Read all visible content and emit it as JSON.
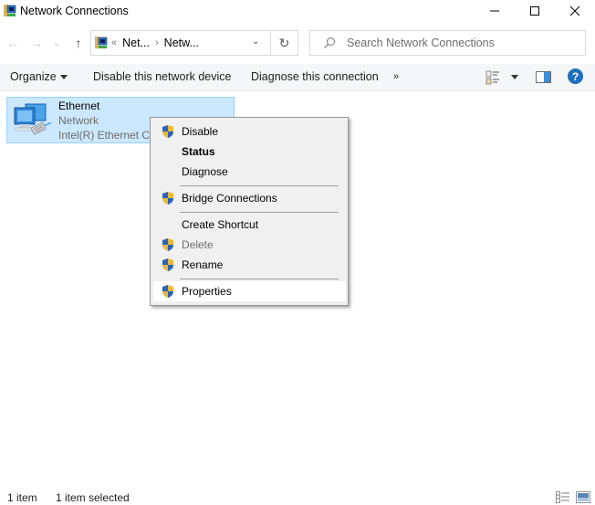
{
  "window": {
    "title": "Network Connections",
    "controls": {
      "minimize": "—",
      "maximize": "☐",
      "close": "✕"
    }
  },
  "navigation": {
    "back_glyph": "←",
    "forward_glyph": "→",
    "recent_glyph": "⌄",
    "up_glyph": "↑",
    "breadcrumb": {
      "overflow": "«",
      "items": [
        "Net...",
        "Netw..."
      ],
      "separator": "›"
    },
    "dropdown_glyph": "⌄",
    "refresh_glyph": "↻",
    "search_placeholder": "Search Network Connections"
  },
  "commandbar": {
    "organize": "Organize",
    "disable_device": "Disable this network device",
    "diagnose": "Diagnose this connection",
    "more": "»",
    "help": "?"
  },
  "items": [
    {
      "name": "Ethernet",
      "type": "Network",
      "device": "Intel(R) Ethernet Co",
      "selected": true
    }
  ],
  "context_menu": {
    "items": [
      {
        "label": "Disable",
        "shield": true,
        "bold": false,
        "disabled": false
      },
      {
        "label": "Status",
        "shield": false,
        "bold": true,
        "disabled": false
      },
      {
        "label": "Diagnose",
        "shield": false,
        "bold": false,
        "disabled": false
      },
      {
        "label": "Bridge Connections",
        "shield": true,
        "bold": false,
        "disabled": false
      },
      {
        "label": "Create Shortcut",
        "shield": false,
        "bold": false,
        "disabled": false
      },
      {
        "label": "Delete",
        "shield": true,
        "bold": false,
        "disabled": true
      },
      {
        "label": "Rename",
        "shield": true,
        "bold": false,
        "disabled": false
      },
      {
        "label": "Properties",
        "shield": true,
        "bold": false,
        "disabled": false,
        "hovered": true
      }
    ]
  },
  "statusbar": {
    "item_count": "1 item",
    "selection": "1 item selected"
  },
  "colors": {
    "selection_bg": "#cce8ff",
    "selection_border": "#99d1ff",
    "menu_bg": "#f0f0f0",
    "help_blue": "#1f6fbf"
  }
}
